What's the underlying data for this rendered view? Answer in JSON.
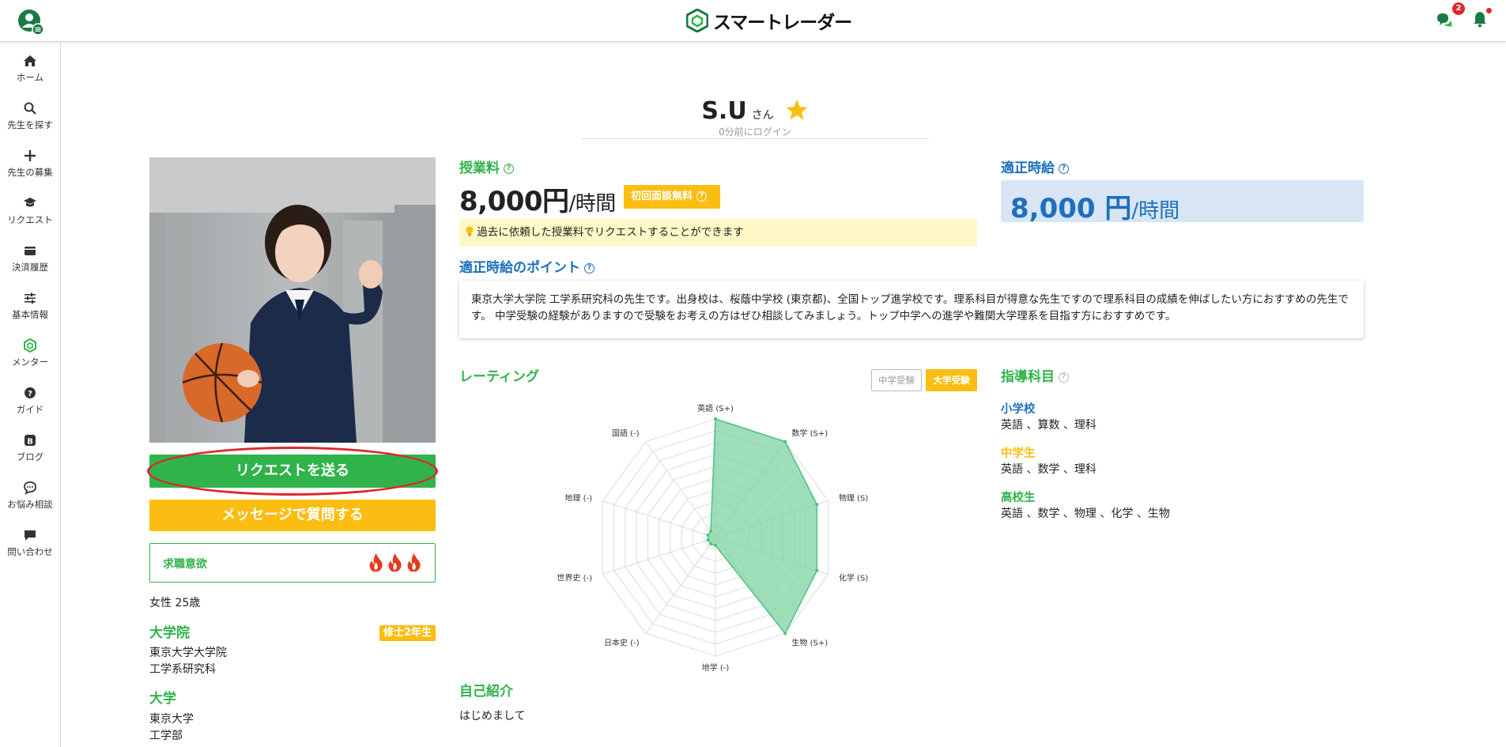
{
  "app": {
    "logo_text": "スマートレーダー"
  },
  "header": {
    "chat_badge_count": "2"
  },
  "sidebar": {
    "items": [
      {
        "label": "ホーム",
        "icon": "home-icon"
      },
      {
        "label": "先生を探す",
        "icon": "search-icon"
      },
      {
        "label": "先生の募集",
        "icon": "plus-icon"
      },
      {
        "label": "リクエスト",
        "icon": "graduation-cap-icon"
      },
      {
        "label": "決済履歴",
        "icon": "wallet-icon"
      },
      {
        "label": "基本情報",
        "icon": "sliders-icon"
      },
      {
        "label": "メンター",
        "icon": "mentor-logo-icon"
      },
      {
        "label": "ガイド",
        "icon": "question-icon"
      },
      {
        "label": "ブログ",
        "icon": "blog-icon"
      },
      {
        "label": "お悩み相談",
        "icon": "chat-bubble-icon"
      },
      {
        "label": "問い合わせ",
        "icon": "message-icon"
      }
    ]
  },
  "profile": {
    "name": "S.U",
    "honorific": "さん",
    "last_login": "0分前にログイン",
    "request_button": "リクエストを送る",
    "message_button": "メッセージで質問する",
    "motivation_label": "求職意欲",
    "motivation_level": 3,
    "gender_age": "女性 25歳",
    "grad_school_heading": "大学院",
    "grad_year_badge": "修士2年生",
    "grad_school_name": "東京大学大学院",
    "grad_school_dept": "工学系研究科",
    "university_heading": "大学",
    "university_name": "東京大学",
    "university_dept": "工学部"
  },
  "fee": {
    "heading": "授業料",
    "amount": "8,000円",
    "unit": "/時間",
    "free_badge": "初回面談無料",
    "note": "過去に依頼した授業料でリクエストすることができます"
  },
  "fair_rate": {
    "heading": "適正時給",
    "amount": "8,000 円",
    "unit": "/時間"
  },
  "points": {
    "heading": "適正時給のポイント",
    "text": "東京大学大学院 工学系研究科の先生です。出身校は、桜蔭中学校 (東京都)、全国トップ進学校です。理系科目が得意な先生ですので理系科目の成績を伸ばしたい方におすすめの先生です。 中学受験の経験がありますので受験をお考えの方はぜひ相談してみましょう。トップ中学への進学や難関大学理系を目指す方におすすめです。"
  },
  "rating": {
    "heading": "レーティング",
    "tabs": [
      "中学受験",
      "大学受験"
    ],
    "active_tab": "大学受験"
  },
  "chart_data": {
    "type": "radar",
    "categories": [
      "英語 (S+)",
      "数学 (S+)",
      "物理 (S)",
      "化学 (S)",
      "生物 (S+)",
      "地学 (-)",
      "日本史 (-)",
      "世界史 (-)",
      "地理 (-)",
      "国語 (-)"
    ],
    "values": [
      10,
      10,
      9,
      9,
      10,
      0,
      0,
      0,
      0,
      0
    ],
    "range": [
      0,
      10
    ],
    "color": "#7dd3a0"
  },
  "subjects": {
    "heading": "指導科目",
    "levels": [
      {
        "level": "小学校",
        "subjects": "英語 、算数 、理科",
        "color": "#1f6fbe"
      },
      {
        "level": "中学生",
        "subjects": "英語 、数学 、理科",
        "color": "#fbbd11"
      },
      {
        "level": "高校生",
        "subjects": "英語 、数学 、物理 、化学 、生物",
        "color": "#2fb34a"
      }
    ]
  },
  "intro": {
    "heading": "自己紹介",
    "text": "はじめまして"
  },
  "colors": {
    "green": "#2fb34a",
    "yellow": "#fbbd11",
    "blue": "#1f6fbe",
    "red": "#e0262d"
  }
}
